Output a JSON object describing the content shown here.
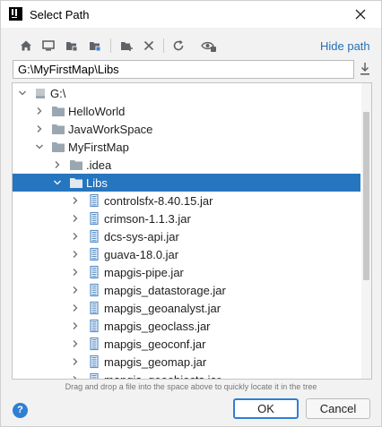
{
  "window": {
    "title": "Select Path",
    "close_icon": "close-icon"
  },
  "toolbar": {
    "buttons": [
      "home-icon",
      "desktop-icon",
      "project-folder-icon",
      "module-folder-icon",
      "new-folder-icon",
      "delete-icon",
      "refresh-icon",
      "show-hidden-icon"
    ],
    "hide_path_label": "Hide path"
  },
  "path_field": {
    "value": "G:\\MyFirstMap\\Libs"
  },
  "tree": {
    "items": [
      {
        "label": "G:\\",
        "kind": "drive",
        "state": "expanded",
        "depth": 0
      },
      {
        "label": "HelloWorld",
        "kind": "folder",
        "state": "collapsed",
        "depth": 1
      },
      {
        "label": "JavaWorkSpace",
        "kind": "folder",
        "state": "collapsed",
        "depth": 1
      },
      {
        "label": "MyFirstMap",
        "kind": "folder",
        "state": "expanded",
        "depth": 1
      },
      {
        "label": ".idea",
        "kind": "folder",
        "state": "collapsed",
        "depth": 2
      },
      {
        "label": "Libs",
        "kind": "folder",
        "state": "expanded",
        "depth": 2,
        "selected": true
      },
      {
        "label": "controlsfx-8.40.15.jar",
        "kind": "jar",
        "state": "collapsed",
        "depth": 3
      },
      {
        "label": "crimson-1.1.3.jar",
        "kind": "jar",
        "state": "collapsed",
        "depth": 3
      },
      {
        "label": "dcs-sys-api.jar",
        "kind": "jar",
        "state": "collapsed",
        "depth": 3
      },
      {
        "label": "guava-18.0.jar",
        "kind": "jar",
        "state": "collapsed",
        "depth": 3
      },
      {
        "label": "mapgis-pipe.jar",
        "kind": "jar",
        "state": "collapsed",
        "depth": 3
      },
      {
        "label": "mapgis_datastorage.jar",
        "kind": "jar",
        "state": "collapsed",
        "depth": 3
      },
      {
        "label": "mapgis_geoanalyst.jar",
        "kind": "jar",
        "state": "collapsed",
        "depth": 3
      },
      {
        "label": "mapgis_geoclass.jar",
        "kind": "jar",
        "state": "collapsed",
        "depth": 3
      },
      {
        "label": "mapgis_geoconf.jar",
        "kind": "jar",
        "state": "collapsed",
        "depth": 3
      },
      {
        "label": "mapgis_geomap.jar",
        "kind": "jar",
        "state": "collapsed",
        "depth": 3
      },
      {
        "label": "mapgis_geoobjects.jar",
        "kind": "jar",
        "state": "collapsed",
        "depth": 3
      }
    ]
  },
  "hint": "Drag and drop a file into the space above to quickly locate it in the tree",
  "buttons": {
    "help": "?",
    "ok": "OK",
    "cancel": "Cancel"
  },
  "colors": {
    "accent": "#2675bf",
    "link": "#2470b3",
    "folder": "#9aa7b0",
    "jar": "#5b8fc7"
  }
}
